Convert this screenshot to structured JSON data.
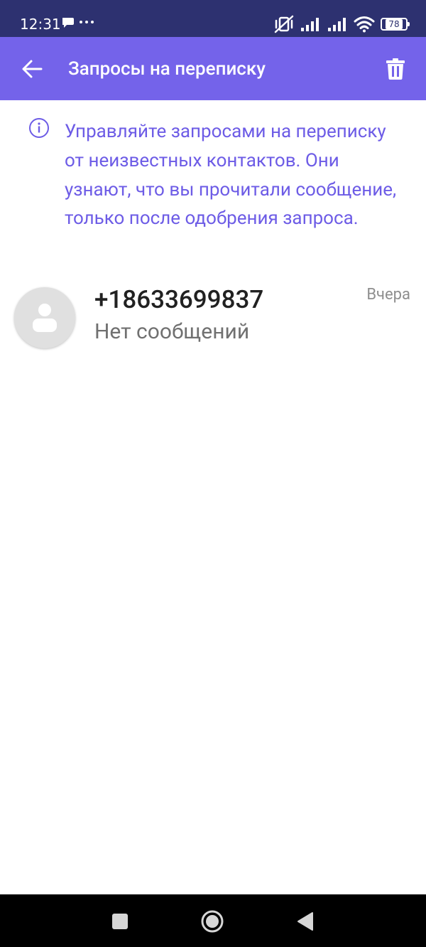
{
  "status_bar": {
    "time": "12:31",
    "battery": "78"
  },
  "app_bar": {
    "title": "Запросы на переписку"
  },
  "info": {
    "text": "Управляйте запросами на переписку от неизвестных контактов. Они узнают, что вы прочитали сообщение, только после одобрения запроса."
  },
  "conversations": [
    {
      "name": "+18633699837",
      "preview": "Нет сообщений",
      "time": "Вчера"
    }
  ],
  "colors": {
    "status_bar_bg": "#2d3170",
    "app_bar_bg": "#7463ea",
    "info_text": "#6d5ce6",
    "avatar_bg": "#e0e0e0"
  }
}
